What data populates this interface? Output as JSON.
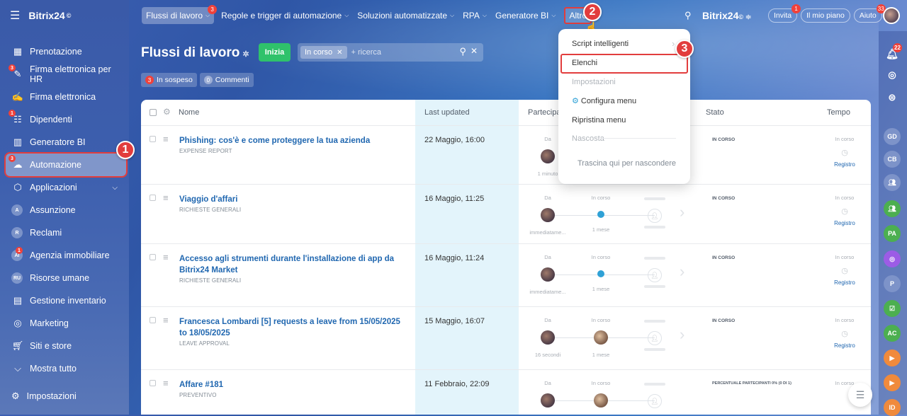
{
  "app": {
    "name": "Bitrix24",
    "mark": "©"
  },
  "sidebar": {
    "items": [
      {
        "label": "Prenotazione",
        "icon": "calendar-icon",
        "badge": ""
      },
      {
        "label": "Firma elettronica per HR",
        "icon": "signature-hr-icon",
        "badge": "3"
      },
      {
        "label": "Firma elettronica",
        "icon": "pen-icon",
        "badge": ""
      },
      {
        "label": "Dipendenti",
        "icon": "employees-icon",
        "badge": "1"
      },
      {
        "label": "Generatore BI",
        "icon": "bar-chart-icon",
        "badge": ""
      },
      {
        "label": "Automazione",
        "icon": "automation-icon",
        "badge": "3"
      },
      {
        "label": "Applicazioni",
        "icon": "cube-icon",
        "badge": ""
      },
      {
        "label": "Assunzione",
        "icon": "A",
        "badge": ""
      },
      {
        "label": "Reclami",
        "icon": "R",
        "badge": ""
      },
      {
        "label": "Agenzia immobiliare",
        "icon": "AI",
        "badge": "1"
      },
      {
        "label": "Risorse umane",
        "icon": "RU",
        "badge": ""
      },
      {
        "label": "Gestione inventario",
        "icon": "inventory-icon",
        "badge": ""
      },
      {
        "label": "Marketing",
        "icon": "marketing-icon",
        "badge": ""
      },
      {
        "label": "Siti e store",
        "icon": "cart-icon",
        "badge": ""
      },
      {
        "label": "Mostra tutto",
        "icon": "chevron-down-icon",
        "badge": ""
      }
    ],
    "settings": "Impostazioni"
  },
  "topnav": {
    "items": [
      "Flussi di lavoro",
      "Regole e trigger di automazione",
      "Soluzioni automatizzate",
      "RPA",
      "Generatore BI",
      "Altro"
    ],
    "flussi_badge": "3",
    "invite": "Invita",
    "invite_badge": "1",
    "plan": "Il mio piano",
    "help": "Aiuto",
    "help_badge": "33"
  },
  "callouts": [
    "1",
    "2",
    "3"
  ],
  "page": {
    "title": "Flussi di lavoro",
    "start_button": "Inizia",
    "filter_tag": "In corso",
    "search_placeholder": "+ ricerca",
    "chips": [
      {
        "count": "3",
        "label": "In sospeso"
      },
      {
        "count": "0",
        "label": "Commenti"
      }
    ]
  },
  "table": {
    "headers": [
      "Nome",
      "Last updated",
      "Partecipanti",
      "Stato",
      "Tempo"
    ],
    "rows": [
      {
        "title": "Phishing: cos'è e come proteggere la tua azienda",
        "sub": "EXPENSE REPORT",
        "updated": "22 Maggio, 16:00",
        "stage_da": "Da",
        "cap1": "1 minuto",
        "stato": "IN CORSO",
        "tempo": "In corso",
        "registro": "Registro"
      },
      {
        "title": "Viaggio d'affari",
        "sub": "RICHIESTE GENERALI",
        "updated": "16 Maggio, 11:25",
        "stage_da": "Da",
        "stage_mid": "In corso",
        "cap1": "immediatame...",
        "cap2": "1 mese",
        "stato": "IN CORSO",
        "tempo": "In corso",
        "registro": "Registro"
      },
      {
        "title": "Accesso agli strumenti durante l'installazione di app da Bitrix24 Market",
        "sub": "RICHIESTE GENERALI",
        "updated": "16 Maggio, 11:24",
        "stage_da": "Da",
        "stage_mid": "In corso",
        "cap1": "immediatame...",
        "cap2": "1 mese",
        "stato": "IN CORSO",
        "tempo": "In corso",
        "registro": "Registro"
      },
      {
        "title": "Francesca Lombardi [5] requests a leave from 15/05/2025 to 18/05/2025",
        "sub": "LEAVE APPROVAL",
        "updated": "15 Maggio, 16:07",
        "stage_da": "Da",
        "stage_mid": "In corso",
        "cap1": "16 secondi",
        "cap2": "1 mese",
        "stato": "IN CORSO",
        "tempo": "In corso",
        "registro": "Registro"
      },
      {
        "title": "Affare #181",
        "sub": "PREVENTIVO",
        "updated": "11 Febbraio, 22:09",
        "stage_da": "Da",
        "stage_mid": "In corso",
        "stato": "PERCENTUALE PARTECIPANTI 0% (0 DI 1)",
        "tempo": "In corso"
      }
    ]
  },
  "dropdown": {
    "items": [
      "Script intelligenti",
      "Elenchi",
      "Impostazioni",
      "Configura menu",
      "Ripristina menu",
      "Nascosta",
      "Trascina qui per nascondere"
    ]
  },
  "rail": {
    "bell_badge": "22",
    "avatars": [
      "GD",
      "CB",
      "PA",
      "P",
      "AC",
      "ID"
    ]
  },
  "colors": {
    "accent_red": "#e23d3d",
    "start_green": "#2fc26b",
    "link_blue": "#2067b0",
    "highlight_col": "#e3f4fb"
  }
}
